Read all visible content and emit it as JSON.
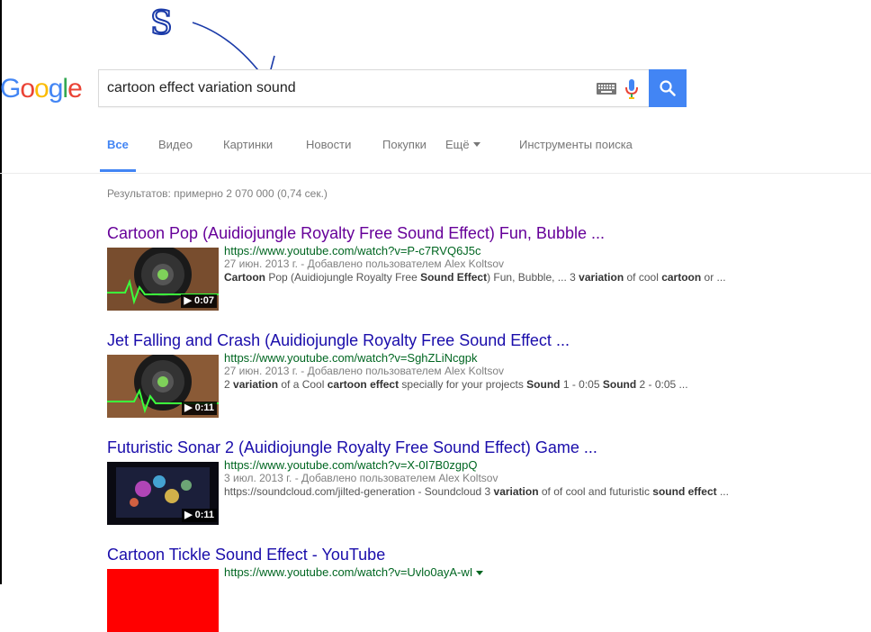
{
  "annotation": {
    "label": "S"
  },
  "logo": {
    "text": "Google"
  },
  "search": {
    "query": "cartoon effect variation sound"
  },
  "tabs": [
    {
      "label": "Все"
    },
    {
      "label": "Видео"
    },
    {
      "label": "Картинки"
    },
    {
      "label": "Новости"
    },
    {
      "label": "Покупки"
    },
    {
      "label": "Ещё"
    },
    {
      "label": "Инструменты поиска"
    }
  ],
  "stats": "Результатов: примерно 2 070 000 (0,74 сек.)",
  "results": [
    {
      "title": "Cartoon Pop (Auidiojungle Royalty Free Sound Effect) Fun, Bubble ...",
      "url": "https://www.youtube.com/watch?v=P-c7RVQ6J5c",
      "meta": "27 июн. 2013 г. - Добавлено пользователем Alex Koltsov",
      "duration": "0:07",
      "snippet_parts": [
        {
          "t": "Cartoon",
          "b": true
        },
        {
          "t": " Pop (Auidiojungle Royalty Free ",
          "b": false
        },
        {
          "t": "Sound Effect",
          "b": true
        },
        {
          "t": ") Fun, Bubble, ... 3 ",
          "b": false
        },
        {
          "t": "variation",
          "b": true
        },
        {
          "t": " of cool ",
          "b": false
        },
        {
          "t": "cartoon",
          "b": true
        },
        {
          "t": " or ...",
          "b": false
        }
      ]
    },
    {
      "title": "Jet Falling and Crash (Auidiojungle Royalty Free Sound Effect ...",
      "url": "https://www.youtube.com/watch?v=SghZLiNcgpk",
      "meta": "27 июн. 2013 г. - Добавлено пользователем Alex Koltsov",
      "duration": "0:11",
      "snippet_parts": [
        {
          "t": "2 ",
          "b": false
        },
        {
          "t": "variation",
          "b": true
        },
        {
          "t": " of a Cool ",
          "b": false
        },
        {
          "t": "cartoon effect",
          "b": true
        },
        {
          "t": " specially for your projects ",
          "b": false
        },
        {
          "t": "Sound",
          "b": true
        },
        {
          "t": " 1 - 0:05 ",
          "b": false
        },
        {
          "t": "Sound",
          "b": true
        },
        {
          "t": " 2 - 0:05 ...",
          "b": false
        }
      ]
    },
    {
      "title": "Futuristic Sonar 2 (Auidiojungle Royalty Free Sound Effect) Game ...",
      "url": "https://www.youtube.com/watch?v=X-0I7B0zgpQ",
      "meta": "3 июл. 2013 г. - Добавлено пользователем Alex Koltsov",
      "duration": "0:11",
      "snippet_parts": [
        {
          "t": "https://soundcloud.com/jilted-generation - Soundcloud 3 ",
          "b": false
        },
        {
          "t": "variation",
          "b": true
        },
        {
          "t": " of of cool and ",
          "b": false
        },
        {
          "t": "futuristic ",
          "b": false
        },
        {
          "t": "sound effect",
          "b": true
        },
        {
          "t": " ...",
          "b": false
        }
      ]
    },
    {
      "title": "Cartoon Tickle Sound Effect - YouTube",
      "url": "https://www.youtube.com/watch?v=Uvlo0ayA-wI"
    }
  ],
  "colors": {
    "accent": "#4285f4",
    "link": "#1a0dab",
    "visited": "#660099",
    "url": "#006621"
  }
}
